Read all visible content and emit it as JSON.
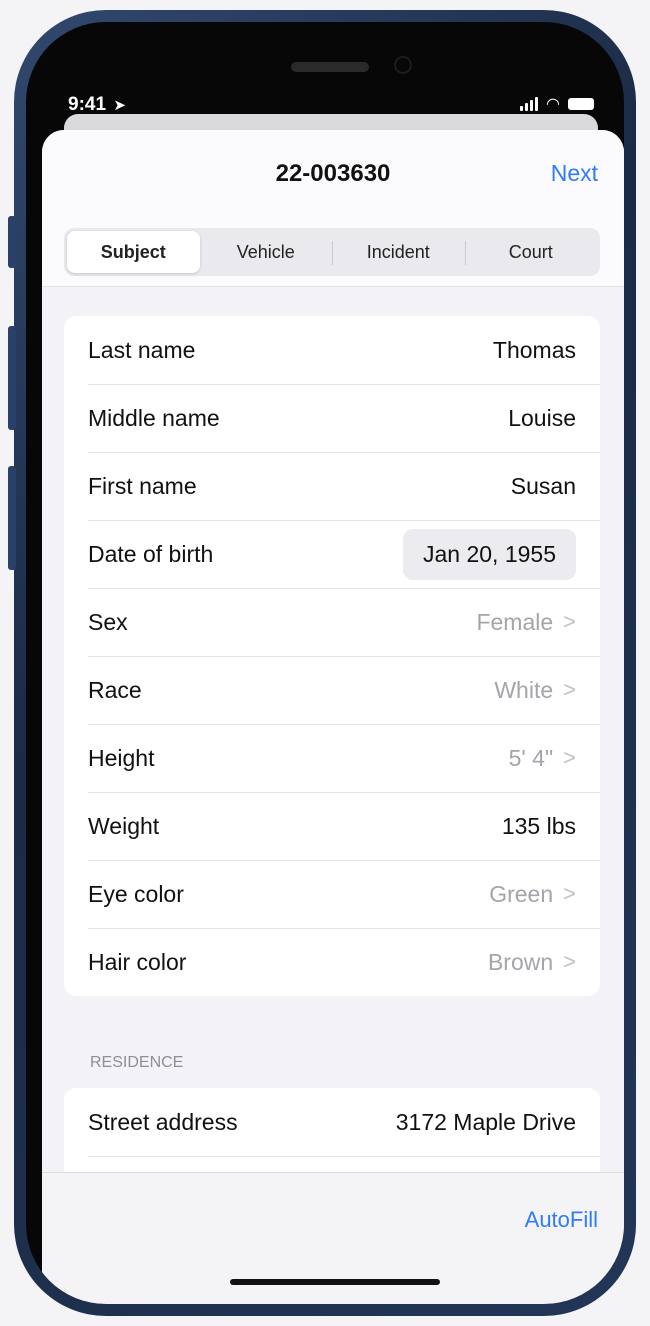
{
  "status_bar": {
    "time": "9:41"
  },
  "nav": {
    "title": "22-003630",
    "next_label": "Next"
  },
  "tabs": [
    {
      "label": "Subject",
      "active": true
    },
    {
      "label": "Vehicle",
      "active": false
    },
    {
      "label": "Incident",
      "active": false
    },
    {
      "label": "Court",
      "active": false
    }
  ],
  "subject": {
    "last_name": {
      "label": "Last name",
      "value": "Thomas"
    },
    "middle_name": {
      "label": "Middle name",
      "value": "Louise"
    },
    "first_name": {
      "label": "First name",
      "value": "Susan"
    },
    "date_of_birth": {
      "label": "Date of birth",
      "value": "Jan 20, 1955"
    },
    "sex": {
      "label": "Sex",
      "value": "Female"
    },
    "race": {
      "label": "Race",
      "value": "White"
    },
    "height": {
      "label": "Height",
      "value": "5' 4\""
    },
    "weight": {
      "label": "Weight",
      "value": "135 lbs"
    },
    "eye_color": {
      "label": "Eye color",
      "value": "Green"
    },
    "hair_color": {
      "label": "Hair color",
      "value": "Brown"
    }
  },
  "residence": {
    "header": "RESIDENCE",
    "street_address": {
      "label": "Street address",
      "value": "3172 Maple Drive"
    }
  },
  "toolbar": {
    "autofill_label": "AutoFill"
  },
  "colors": {
    "accent": "#2f7cf6",
    "frame": "#1f2f4d"
  }
}
